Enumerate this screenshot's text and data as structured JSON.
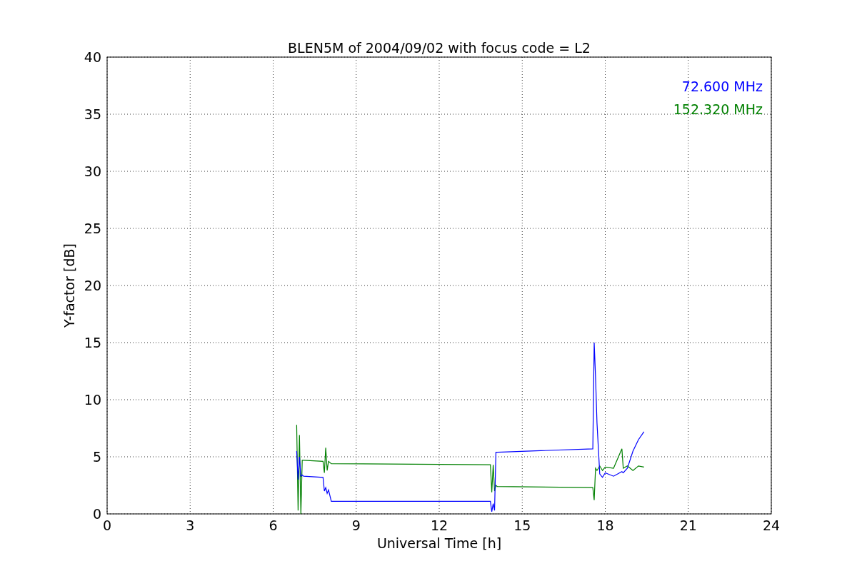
{
  "chart_data": {
    "type": "line",
    "title": "BLEN5M of 2004/09/02 with focus code = L2",
    "xlabel": "Universal Time [h]",
    "ylabel": "Y-factor [dB]",
    "x": [
      6.85,
      6.9,
      6.95,
      7.0,
      7.05,
      7.1,
      7.8,
      7.85,
      7.9,
      7.95,
      8.0,
      8.1,
      13.85,
      13.9,
      13.95,
      14.0,
      14.05,
      14.1,
      17.55,
      17.6,
      17.65,
      17.7,
      17.8,
      17.9,
      18.0,
      18.3,
      18.6,
      18.65,
      18.8,
      19.0,
      19.2,
      19.4
    ],
    "series": [
      {
        "name": "72.600 MHz",
        "color": "#0000ff",
        "values": [
          5.5,
          3.0,
          5.0,
          3.3,
          3.4,
          3.3,
          3.2,
          2.0,
          2.3,
          1.8,
          2.1,
          1.1,
          1.1,
          0.2,
          0.9,
          0.3,
          5.4,
          5.4,
          5.7,
          15.0,
          12.0,
          8.0,
          3.5,
          3.2,
          3.6,
          3.3,
          3.7,
          3.6,
          4.0,
          5.5,
          6.5,
          7.2
        ]
      },
      {
        "name": "152.320 MHz",
        "color": "#008000",
        "values": [
          7.8,
          0.3,
          6.9,
          0.0,
          4.7,
          4.7,
          4.6,
          3.6,
          5.8,
          3.8,
          4.6,
          4.4,
          4.3,
          1.9,
          4.3,
          2.0,
          2.5,
          2.4,
          2.3,
          1.2,
          4.0,
          3.8,
          4.2,
          3.8,
          4.1,
          4.0,
          5.7,
          4.0,
          4.2,
          3.8,
          4.2,
          4.1
        ]
      }
    ],
    "grid": true,
    "xlim": [
      0,
      24
    ],
    "ylim": [
      0,
      40
    ],
    "xticks": [
      0,
      3,
      6,
      9,
      12,
      15,
      18,
      21,
      24
    ],
    "yticks": [
      0,
      5,
      10,
      15,
      20,
      25,
      30,
      35,
      40
    ]
  }
}
